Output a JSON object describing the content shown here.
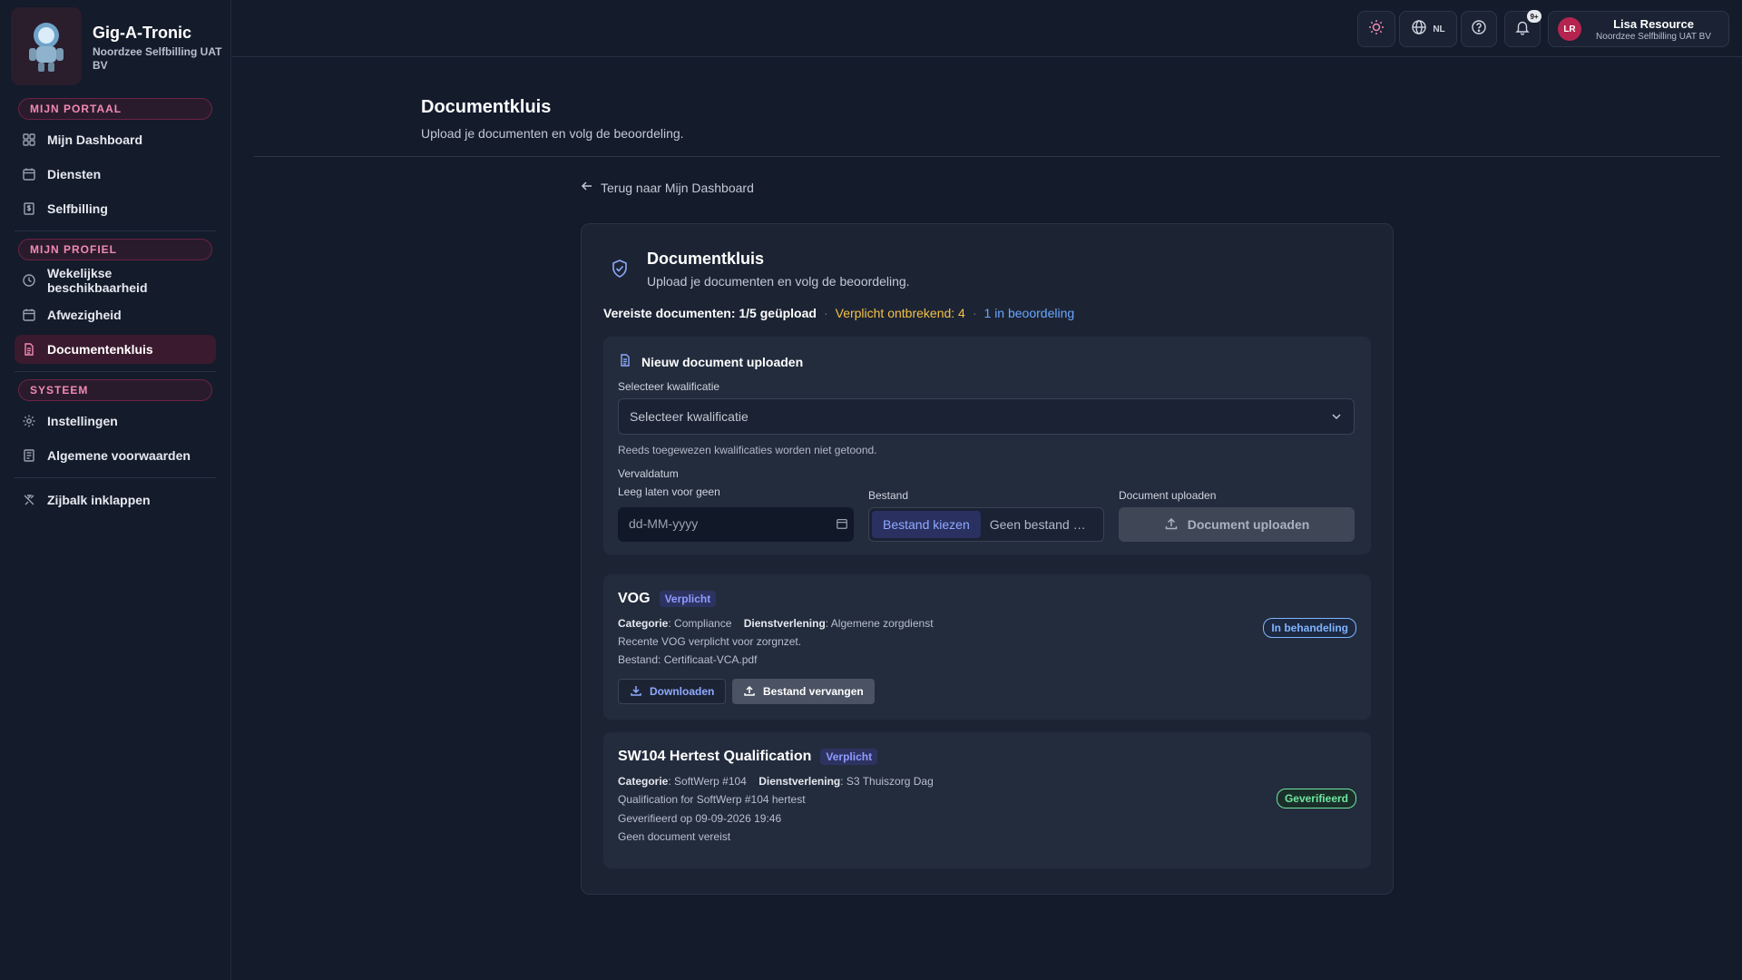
{
  "brand": {
    "title": "Gig-A-Tronic",
    "subtitle": "Noordzee Selfbilling UAT BV"
  },
  "sidebar": {
    "sections": [
      {
        "label": "MIJN PORTAAL",
        "items": [
          "Mijn Dashboard",
          "Diensten",
          "Selfbilling"
        ]
      },
      {
        "label": "MIJN PROFIEL",
        "items": [
          "Wekelijkse beschikbaarheid",
          "Afwezigheid",
          "Documentenkluis"
        ]
      },
      {
        "label": "SYSTEEM",
        "items": [
          "Instellingen",
          "Algemene voorwaarden"
        ]
      }
    ],
    "collapse_label": "Zijbalk inklappen",
    "active_item": "Documentenkluis"
  },
  "topbar": {
    "language": "NL",
    "notif_badge": "9+",
    "user": {
      "initials": "LR",
      "name": "Lisa Resource",
      "org": "Noordzee Selfbilling UAT BV"
    }
  },
  "page": {
    "title": "Documentkluis",
    "subtitle": "Upload je documenten en volg de beoordeling.",
    "back_link": "Terug naar Mijn Dashboard"
  },
  "card": {
    "title": "Documentkluis",
    "subtitle": "Upload je documenten en volg de beoordeling.",
    "summary": {
      "required": "Vereiste documenten: 1/5 geüpload",
      "missing": "Verplicht ontbrekend: 4",
      "in_review": "1 in beoordeling"
    }
  },
  "upload": {
    "heading": "Nieuw document uploaden",
    "qual_label": "Selecteer kwalificatie",
    "qual_placeholder": "Selecteer kwalificatie",
    "qual_hint": "Reeds toegewezen kwalificaties worden niet getoond.",
    "expiry_label": "Vervaldatum",
    "expiry_hint": "Leeg laten voor geen",
    "expiry_placeholder": "dd-MM-yyyy",
    "file_label": "Bestand",
    "file_choose": "Bestand kiezen",
    "file_none": "Geen bestand gekozen",
    "upload_label": "Document uploaden",
    "upload_button": "Document uploaden"
  },
  "documents": [
    {
      "title": "VOG",
      "tag": "Verplicht",
      "category_label": "Categorie",
      "category": "Compliance",
      "service_label": "Dienstverlening",
      "service": "Algemene zorgdienst",
      "line1": "Recente VOG verplicht voor zorgnzet.",
      "line2": "Bestand: Certificaat-VCA.pdf",
      "status": "In behandeling",
      "download": "Downloaden",
      "replace": "Bestand vervangen"
    },
    {
      "title": "SW104 Hertest Qualification",
      "tag": "Verplicht",
      "category_label": "Categorie",
      "category": "SoftWerp #104",
      "service_label": "Dienstverlening",
      "service": "S3 Thuiszorg Dag",
      "line1": "Qualification for SoftWerp #104 hertest",
      "line2": "Geverifieerd op 09-09-2026 19:46",
      "line3": "Geen document vereist",
      "status": "Geverifieerd"
    }
  ],
  "colors": {
    "accent_pink": "#f08ab4",
    "warning": "#f5c044",
    "info": "#6aa6ff",
    "success": "#6ee7a0"
  }
}
